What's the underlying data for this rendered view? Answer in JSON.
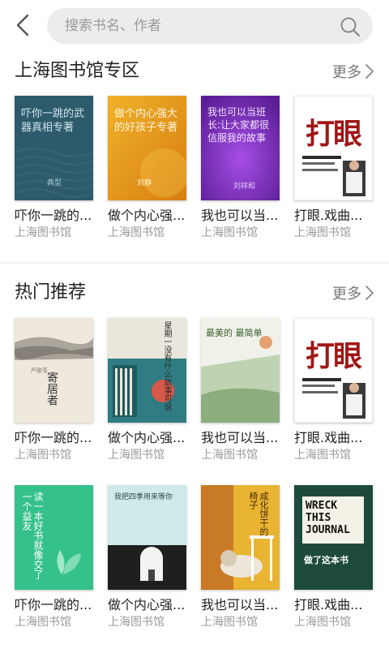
{
  "header": {
    "search_placeholder": "搜索书名、作者",
    "back_icon": "chevron-left-icon",
    "search_icon": "search-icon"
  },
  "sections": [
    {
      "title": "上海图书馆专区",
      "more": "更多",
      "books": [
        {
          "title": "吓你一跳的...",
          "library": "上海图书馆",
          "cover_text": "吓你一跳的武器真相专著",
          "cover_author": "典型",
          "cover_color": "#2e5b6b"
        },
        {
          "title": "做个内心强...",
          "library": "上海图书馆",
          "cover_text": "做个内心强大的好孩子专著",
          "cover_author": "刘静",
          "cover_color": "#e89a1c"
        },
        {
          "title": "我也可以当...",
          "library": "上海图书馆",
          "cover_text": "我也可以当班长:让大家都很信服我的故事",
          "cover_author": "刘祥和",
          "cover_color": "#7b2fb8"
        },
        {
          "title": "打眼.戏曲...",
          "library": "上海图书馆",
          "cover_text": "打眼",
          "cover_author": "",
          "cover_color": "#ffffff"
        }
      ]
    },
    {
      "title": "热门推荐",
      "more": "更多",
      "books": [
        {
          "title": "吓你一跳的...",
          "library": "上海图书馆",
          "cover_text": "寄居者",
          "cover_author": "严歌苓",
          "cover_color": "#efe9dd"
        },
        {
          "title": "做个内心强...",
          "library": "上海图书馆",
          "cover_text": "星期一没有什么故事可说",
          "cover_author": "",
          "cover_color": "#2f7c82"
        },
        {
          "title": "我也可以当...",
          "library": "上海图书馆",
          "cover_text": "最美的 最简单",
          "cover_author": "",
          "cover_color": "#f1f1ea"
        },
        {
          "title": "打眼.戏曲...",
          "library": "上海图书馆",
          "cover_text": "打眼",
          "cover_author": "",
          "cover_color": "#ffffff"
        },
        {
          "title": "吓你一跳的...",
          "library": "上海图书馆",
          "cover_text": "读一本好书就像交了一个益友",
          "cover_author": "",
          "cover_color": "#35c18a"
        },
        {
          "title": "做个内心强...",
          "library": "上海图书馆",
          "cover_text": "我把四季用来等你",
          "cover_author": "",
          "cover_color": "#cfe8e8"
        },
        {
          "title": "我也可以当...",
          "library": "上海图书馆",
          "cover_text": "咸化饼干的椅子",
          "cover_author": "",
          "cover_color": "#e8b431"
        },
        {
          "title": "打眼.戏曲...",
          "library": "上海图书馆",
          "cover_text": "WRECK THIS JOURNAL",
          "cover_author": "做了这本书",
          "cover_color": "#1d4a3c"
        }
      ]
    }
  ]
}
